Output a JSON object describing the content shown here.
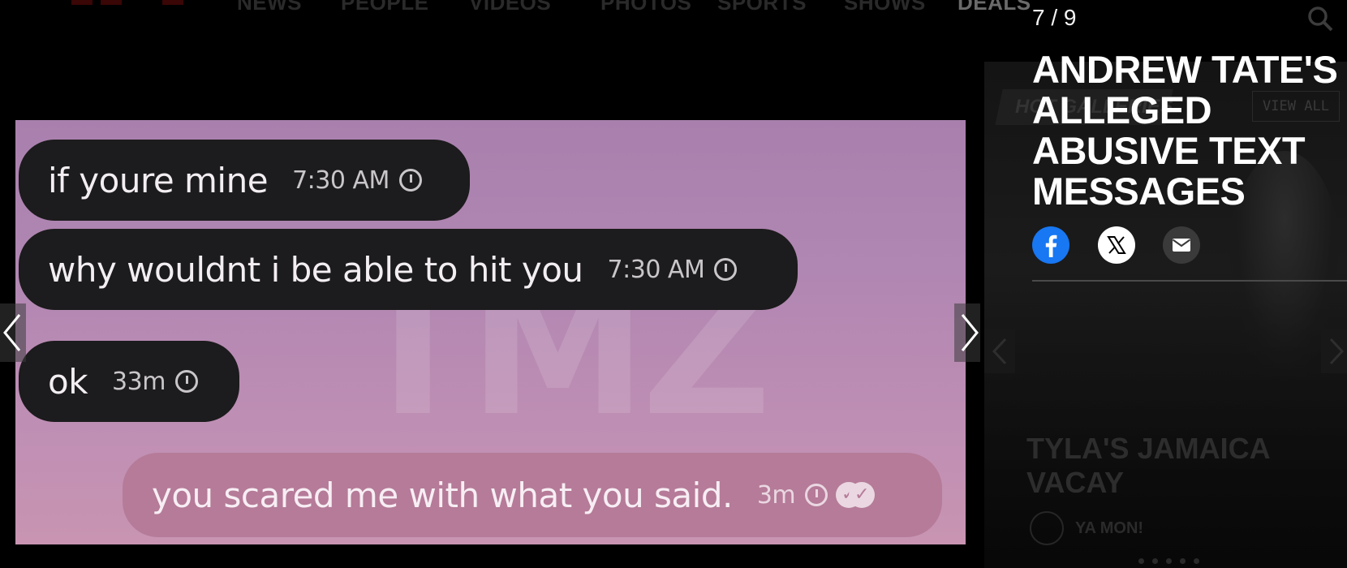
{
  "nav": {
    "items": [
      "NEWS",
      "PEOPLE",
      "VIDEOS",
      "PHOTOS",
      "SPORTS",
      "SHOWS",
      "DEALS"
    ]
  },
  "gallery": {
    "counter": "7 / 9",
    "title_lines": [
      "ANDREW TATE'S",
      "ALLEGED",
      "ABUSIVE TEXT",
      "MESSAGES"
    ]
  },
  "chat": {
    "messages": [
      {
        "text": "if youre mine",
        "time": "7:30 AM"
      },
      {
        "text": "why wouldnt i be able to hit you",
        "time": "7:30 AM"
      },
      {
        "text": "ok",
        "time": "33m"
      },
      {
        "text": "you scared me with what you said.",
        "time": "3m"
      }
    ],
    "watermark": "TMZ"
  },
  "rail": {
    "heading": "HOT GALLERIES",
    "view_all": "VIEW ALL",
    "card_title": "TYLA'S JAMAICA VACAY",
    "card_tag": "YA MON!"
  },
  "share": {
    "facebook_icon": "facebook-icon",
    "x_icon": "x-icon",
    "mail_icon": "mail-icon"
  },
  "colors": {
    "facebook": "#1877f2",
    "bubble_dark": "#1c1b1d",
    "bubble_own": "#b57b98",
    "photo_bg": "#b086b2"
  }
}
